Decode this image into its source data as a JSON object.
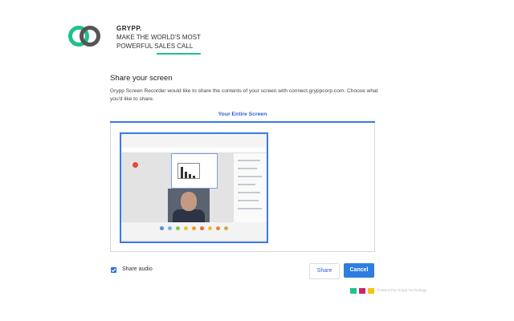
{
  "brand": {
    "name": "GRYPP.",
    "tagline_line1": "MAKE THE WORLD'S MOST",
    "tagline_line2": "POWERFUL SALES CALL",
    "colors": {
      "accent": "#1ec28b",
      "dark": "#555555"
    }
  },
  "dialog": {
    "title": "Share your screen",
    "description": "Grypp Screen Recorder would like to share the contents of your screen with connect.gryppcorp.com. Choose what you'd like to share.",
    "tabs": [
      {
        "label": "Your Entire Screen",
        "selected": true
      }
    ],
    "share_audio": {
      "label": "Share audio",
      "checked": true
    },
    "buttons": {
      "share": "Share",
      "cancel": "Cancel"
    }
  },
  "footer": {
    "swatch_colors": [
      "#1ec28b",
      "#d1236a",
      "#f3c31a"
    ],
    "text": "Powered by Grypp Technology"
  }
}
